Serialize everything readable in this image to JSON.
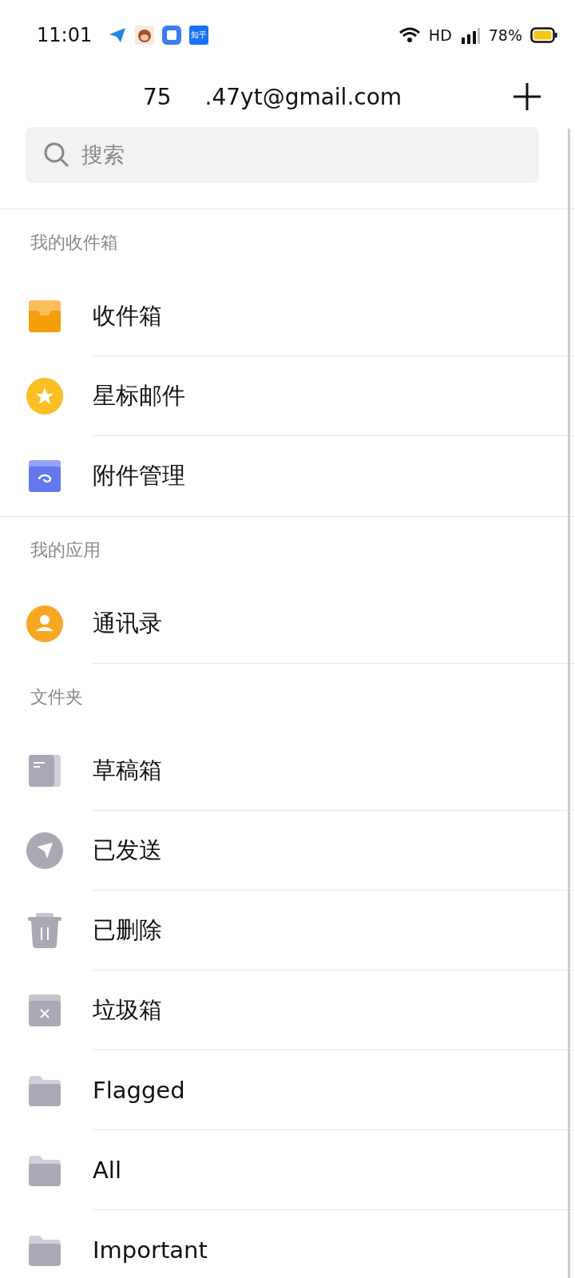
{
  "status_bar": {
    "time": "11:01",
    "notification_app_label": "知乎",
    "network": "HD",
    "battery": "78%"
  },
  "header": {
    "account_parts": [
      "75",
      ".47yt@gmail.com"
    ]
  },
  "search": {
    "placeholder": "搜索"
  },
  "sections": [
    {
      "title": "我的收件箱",
      "items": [
        {
          "label": "收件箱",
          "kind": "inbox"
        },
        {
          "label": "星标邮件",
          "kind": "star"
        },
        {
          "label": "附件管理",
          "kind": "attachment"
        }
      ]
    },
    {
      "title": "我的应用",
      "items": [
        {
          "label": "通讯录",
          "kind": "contacts"
        }
      ]
    },
    {
      "title": "文件夹",
      "items": [
        {
          "label": "草稿箱",
          "kind": "drafts"
        },
        {
          "label": "已发送",
          "kind": "sent"
        },
        {
          "label": "已删除",
          "kind": "trash"
        },
        {
          "label": "垃圾箱",
          "kind": "spam"
        },
        {
          "label": "Flagged",
          "kind": "folder"
        },
        {
          "label": "All",
          "kind": "folder"
        },
        {
          "label": "Important",
          "kind": "folder"
        }
      ]
    }
  ]
}
